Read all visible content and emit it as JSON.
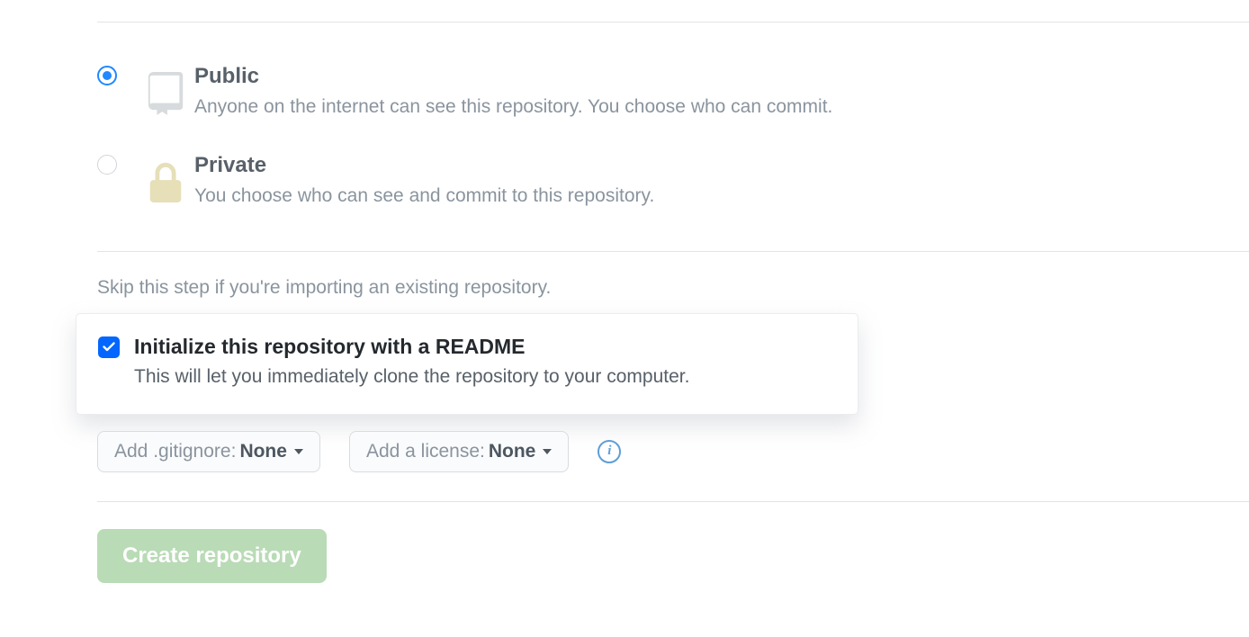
{
  "visibility": {
    "public": {
      "title": "Public",
      "desc": "Anyone on the internet can see this repository. You choose who can commit."
    },
    "private": {
      "title": "Private",
      "desc": "You choose who can see and commit to this repository."
    }
  },
  "skip_text": "Skip this step if you're importing an existing repository.",
  "readme": {
    "title": "Initialize this repository with a README",
    "desc": "This will let you immediately clone the repository to your computer."
  },
  "gitignore": {
    "label": "Add .gitignore:",
    "value": "None"
  },
  "license": {
    "label": "Add a license:",
    "value": "None"
  },
  "create_button": "Create repository"
}
